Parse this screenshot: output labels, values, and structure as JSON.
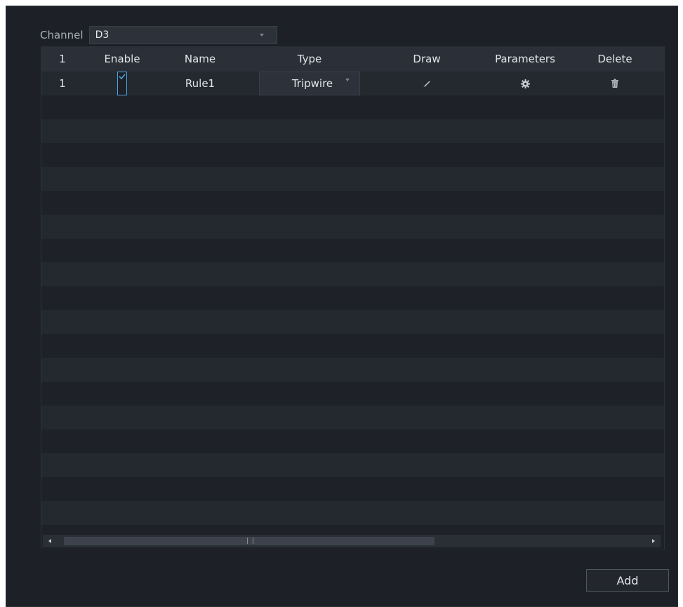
{
  "channel": {
    "label": "Channel",
    "value": "D3"
  },
  "table": {
    "headers": {
      "no": "1",
      "enable": "Enable",
      "name": "Name",
      "type": "Type",
      "draw": "Draw",
      "parameters": "Parameters",
      "delete": "Delete"
    },
    "rows": [
      {
        "no": "1",
        "enabled": true,
        "name": "Rule1",
        "type": "Tripwire"
      }
    ]
  },
  "icons": {
    "draw": "pencil-icon",
    "parameters": "gear-icon",
    "delete": "trash-icon"
  },
  "buttons": {
    "add": "Add"
  },
  "colors": {
    "panel_bg": "#1d2127",
    "header_bg": "#2b3038",
    "accent": "#4aa3e0",
    "text": "#e1e4e8"
  }
}
